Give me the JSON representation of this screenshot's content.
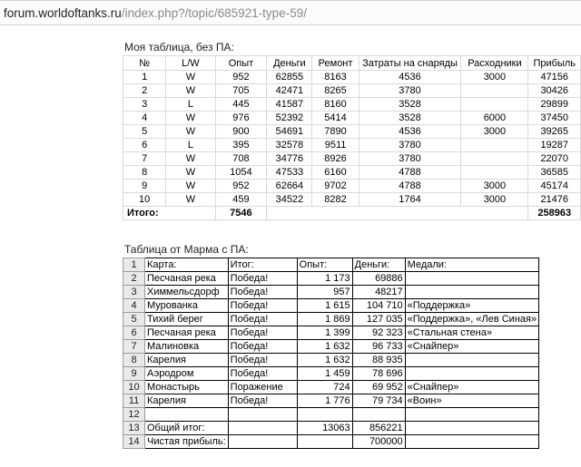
{
  "address_bar": {
    "domain": "forum.worldoftanks.ru",
    "path": "/index.php?/topic/685921-type-59/"
  },
  "table1": {
    "caption": "Моя таблица, без ПА:",
    "headers": [
      "№",
      "L/W",
      "Опыт",
      "Деньги",
      "Ремонт",
      "Затраты на снаряды",
      "Расходники",
      "Прибыль"
    ],
    "rows": [
      [
        "1",
        "W",
        "952",
        "62855",
        "8163",
        "4536",
        "3000",
        "47156"
      ],
      [
        "2",
        "W",
        "705",
        "42471",
        "8265",
        "3780",
        "",
        "30426"
      ],
      [
        "3",
        "L",
        "445",
        "41587",
        "8160",
        "3528",
        "",
        "29899"
      ],
      [
        "4",
        "W",
        "976",
        "52392",
        "5414",
        "3528",
        "6000",
        "37450"
      ],
      [
        "5",
        "W",
        "900",
        "54691",
        "7890",
        "4536",
        "3000",
        "39265"
      ],
      [
        "6",
        "L",
        "395",
        "32578",
        "9511",
        "3780",
        "",
        "19287"
      ],
      [
        "7",
        "W",
        "708",
        "34776",
        "8926",
        "3780",
        "",
        "22070"
      ],
      [
        "8",
        "W",
        "1054",
        "47533",
        "6160",
        "4788",
        "",
        "36585"
      ],
      [
        "9",
        "W",
        "952",
        "62664",
        "9702",
        "4788",
        "3000",
        "45174"
      ],
      [
        "10",
        "W",
        "459",
        "34522",
        "8282",
        "1764",
        "3000",
        "21476"
      ]
    ],
    "total": {
      "label": "Итого:",
      "exp": "7546",
      "profit": "258963"
    }
  },
  "table2": {
    "caption": "Таблица от Марма с ПА:",
    "rows": [
      [
        "1",
        "Карта:",
        "Итог:",
        "Опыт:",
        "Деньги:",
        "Медали:"
      ],
      [
        "2",
        "Песчаная река",
        "Победа!",
        "1 173",
        "69886",
        ""
      ],
      [
        "3",
        "Химмельсдорф",
        "Победа!",
        "957",
        "48217",
        ""
      ],
      [
        "4",
        "Мурованка",
        "Победа!",
        "1 615",
        "104 710",
        "«Поддержка»"
      ],
      [
        "5",
        "Тихий берег",
        "Победа!",
        "1 869",
        "127 035",
        "«Поддержка», «Лев Синая»"
      ],
      [
        "6",
        "Песчаная река",
        "Победа!",
        "1 399",
        "92 323",
        "«Стальная стена»"
      ],
      [
        "7",
        "Малиновка",
        "Победа!",
        "1 632",
        "96 733",
        "«Снайпер»"
      ],
      [
        "8",
        "Карелия",
        "Победа!",
        "1 632",
        "88 935",
        ""
      ],
      [
        "9",
        "Аэродром",
        "Победа!",
        "1 459",
        "78 696",
        ""
      ],
      [
        "10",
        "Монастырь",
        "Поражение",
        "724",
        "69 952",
        "«Снайпер»"
      ],
      [
        "11",
        "Карелия",
        "Победа!",
        "1 776",
        "79 734",
        "«Воин»"
      ],
      [
        "12",
        "",
        "",
        "",
        "",
        ""
      ],
      [
        "13",
        "Общий итог:",
        "",
        "13063",
        "856221",
        ""
      ],
      [
        "14",
        "Чистая прибыль:",
        "",
        "",
        "700000",
        ""
      ]
    ]
  }
}
